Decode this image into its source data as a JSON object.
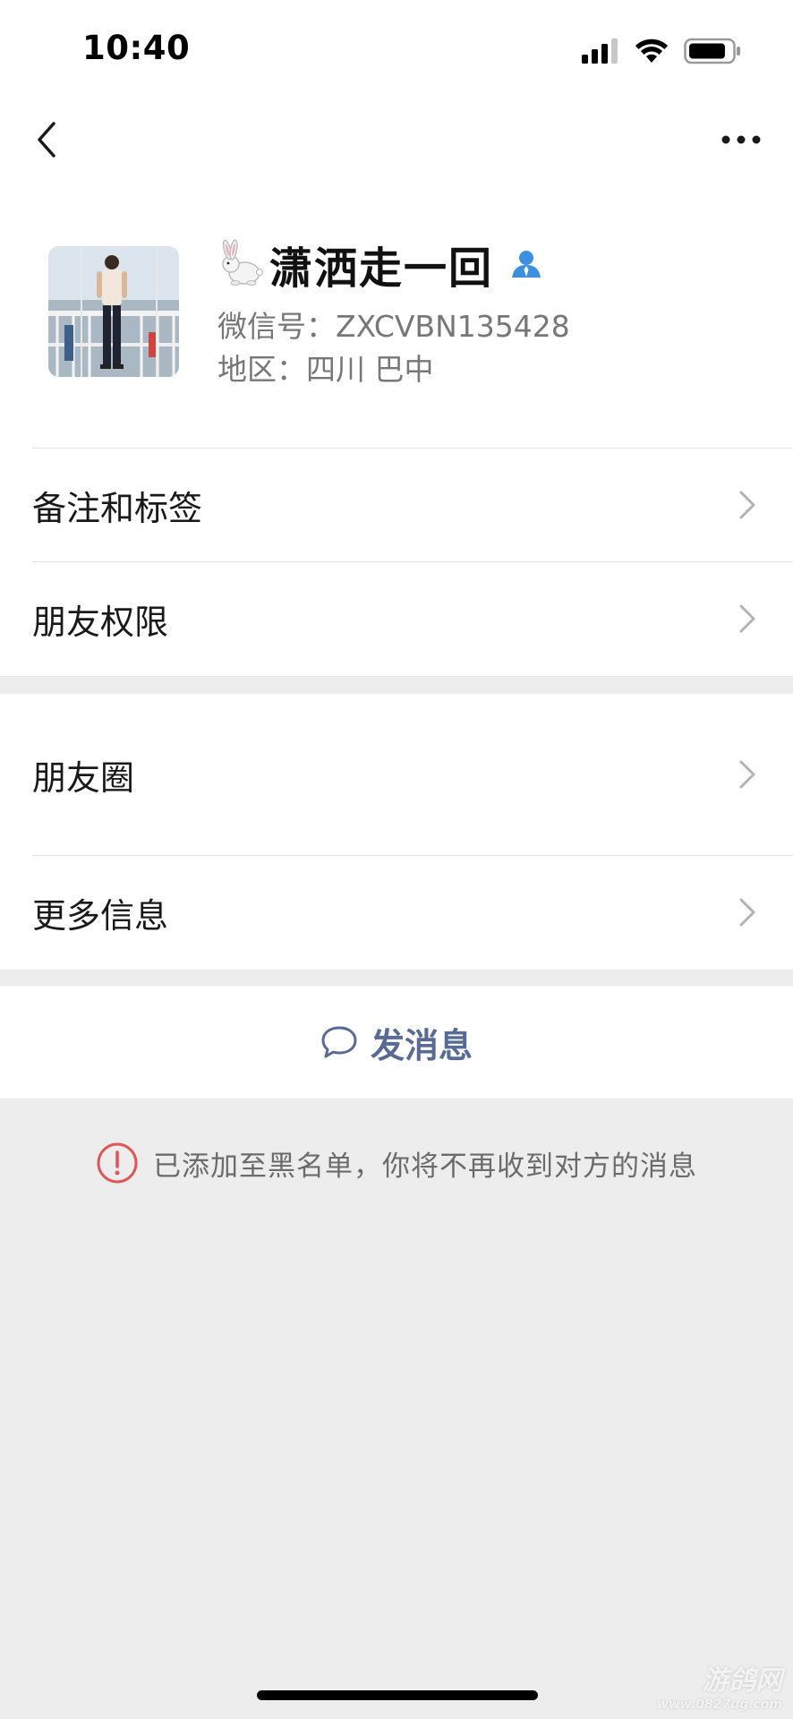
{
  "status_bar": {
    "time": "10:40"
  },
  "nav": {
    "back_icon": "chevron-left-icon",
    "more_icon": "ellipsis-icon"
  },
  "profile": {
    "name_emoji": "rabbit-icon",
    "name": "潇洒走一回",
    "wechat_id": "微信号：ZXCVBN135428",
    "region": "地区：四川 巴中"
  },
  "menu": {
    "remarks_tags": "备注和标签",
    "friend_permissions": "朋友权限",
    "moments": "朋友圈",
    "more_info": "更多信息"
  },
  "actions": {
    "send_message": "发消息"
  },
  "notice": {
    "blacklist": "已添加至黑名单，你将不再收到对方的消息"
  },
  "watermark": {
    "top": "游鸽网",
    "bottom": "www.0827ug.com"
  },
  "colors": {
    "link_blue": "#576b95",
    "warning_red": "#e05555",
    "background_gray": "#ededed",
    "verified_blue": "#3d8fe0"
  }
}
